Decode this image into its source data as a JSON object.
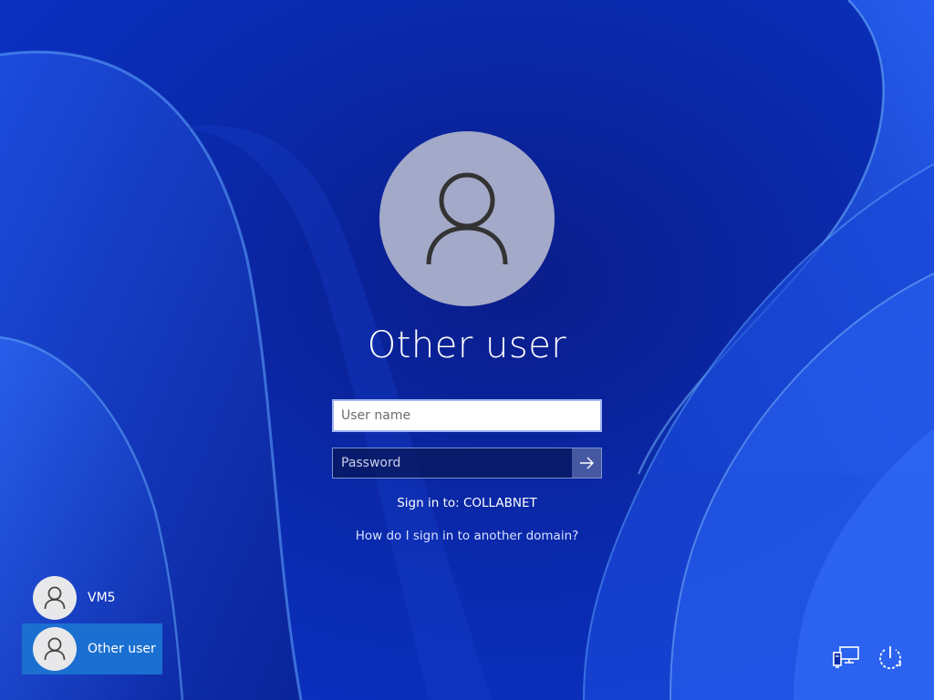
{
  "login": {
    "title": "Other user",
    "username_placeholder": "User name",
    "password_placeholder": "Password",
    "signin_to": "Sign in to: COLLABNET",
    "help_link": "How do I sign in to another domain?"
  },
  "users": [
    {
      "label": "VM5",
      "selected": false
    },
    {
      "label": "Other user",
      "selected": true
    }
  ],
  "icons": {
    "avatar": "person-icon",
    "submit": "arrow-right-icon",
    "network": "network-icon",
    "power": "power-icon"
  },
  "colors": {
    "background": "#0b2aa8",
    "avatar_bg": "#a3a9c8",
    "selected_tile": "#1a6fd0"
  }
}
